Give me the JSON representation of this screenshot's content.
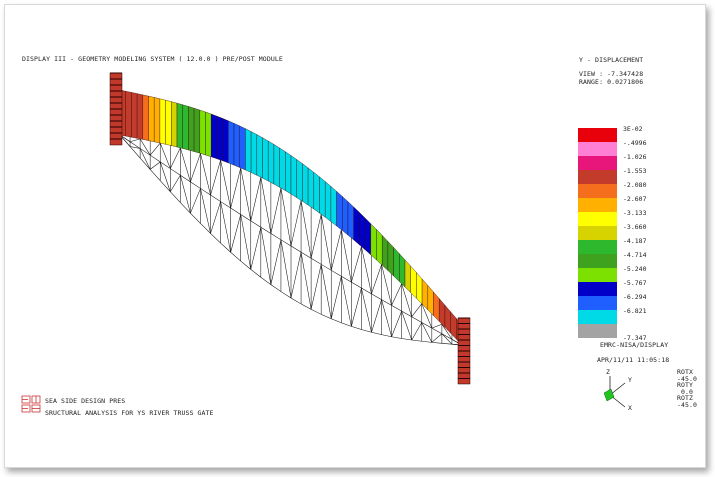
{
  "header": {
    "title": "DISPLAY III - GEOMETRY MODELING SYSTEM ( 12.0.0 )  PRE/POST MODULE"
  },
  "result": {
    "quantity": "Y - DISPLACEMENT",
    "view_line": "VIEW : -7.347428",
    "range_line": "RANGE: 0.0271806"
  },
  "legend": {
    "labels": [
      "3E-02",
      "-.4996",
      "-1.026",
      "-1.553",
      "-2.080",
      "-2.607",
      "-3.133",
      "-3.660",
      "-4.187",
      "-4.714",
      "-5.240",
      "-5.767",
      "-6.294",
      "-6.821",
      "-7.347"
    ],
    "colors": [
      "#e8000b",
      "#ff7fd4",
      "#e8157a",
      "#c23b2b",
      "#f56e1e",
      "#ffb000",
      "#ffff00",
      "#d6d300",
      "#2eb82e",
      "#3fa21f",
      "#7ce100",
      "#0000c8",
      "#1f5fff",
      "#00d9e6",
      "#a3a3a3"
    ]
  },
  "footer_right": {
    "system": "EMRC-NISA/DISPLAY",
    "date": "APR/11/11 11:05:18"
  },
  "rotation": {
    "lines": [
      "ROTX",
      "-45.0",
      "ROTY",
      "0.0",
      "ROTZ",
      "-45.0"
    ]
  },
  "triad": {
    "z": "Z",
    "y": "Y",
    "x": "X"
  },
  "company": {
    "logo_text": "EMRC",
    "name": "SEA SIDE DESIGN PRES",
    "subtitle": "SRUCTURAL ANALYSIS FOR YS RIVER TRUSS GATE"
  },
  "colors": {
    "background": "#ffffff",
    "line": "#000000",
    "logo": "#cc3333"
  }
}
